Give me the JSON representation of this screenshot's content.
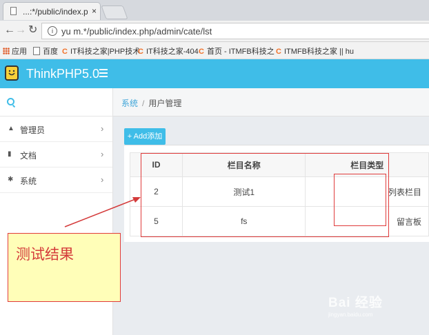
{
  "browser": {
    "tab_title": "...:*/public/index.pl",
    "tab_close": "×",
    "url": "yu m.*/public/index.php/admin/cate/lst",
    "bookmarks": [
      {
        "icon": "apps-grid-icon",
        "label": "应用"
      },
      {
        "icon": "page-icon",
        "label": "百度"
      },
      {
        "icon": "c-favicon-icon",
        "label": "IT科技之家|PHP技术"
      },
      {
        "icon": "c-favicon-icon",
        "label": "IT科技之家-404"
      },
      {
        "icon": "c-favicon-icon",
        "label": "首页 - ITMFB科技之"
      },
      {
        "icon": "c-favicon-icon",
        "label": "ITMFB科技之家 || hu"
      }
    ]
  },
  "header": {
    "app_title": "ThinkPHP5.0",
    "accent_color": "#3fbde8"
  },
  "sidebar": {
    "items": [
      {
        "icon": "user-icon",
        "label": "管理员",
        "chevron": "›"
      },
      {
        "icon": "document-icon",
        "label": "文档",
        "chevron": "›"
      },
      {
        "icon": "gear-icon",
        "label": "系统",
        "chevron": "›"
      }
    ]
  },
  "breadcrumb": {
    "root": "系统",
    "sep": "/",
    "current": "用户管理"
  },
  "toolbar": {
    "add_label": "+ Add添加"
  },
  "table": {
    "columns": [
      "ID",
      "栏目名称",
      "栏目类型"
    ],
    "rows": [
      [
        "2",
        "测试1",
        "列表栏目"
      ],
      [
        "5",
        "fs",
        "留言板"
      ]
    ]
  },
  "annotation": {
    "note_text": "测试结果",
    "highlight_color": "#e03a3a"
  },
  "watermark": {
    "brand": "Bai  经验",
    "url": "jingyan.baidu.com"
  }
}
